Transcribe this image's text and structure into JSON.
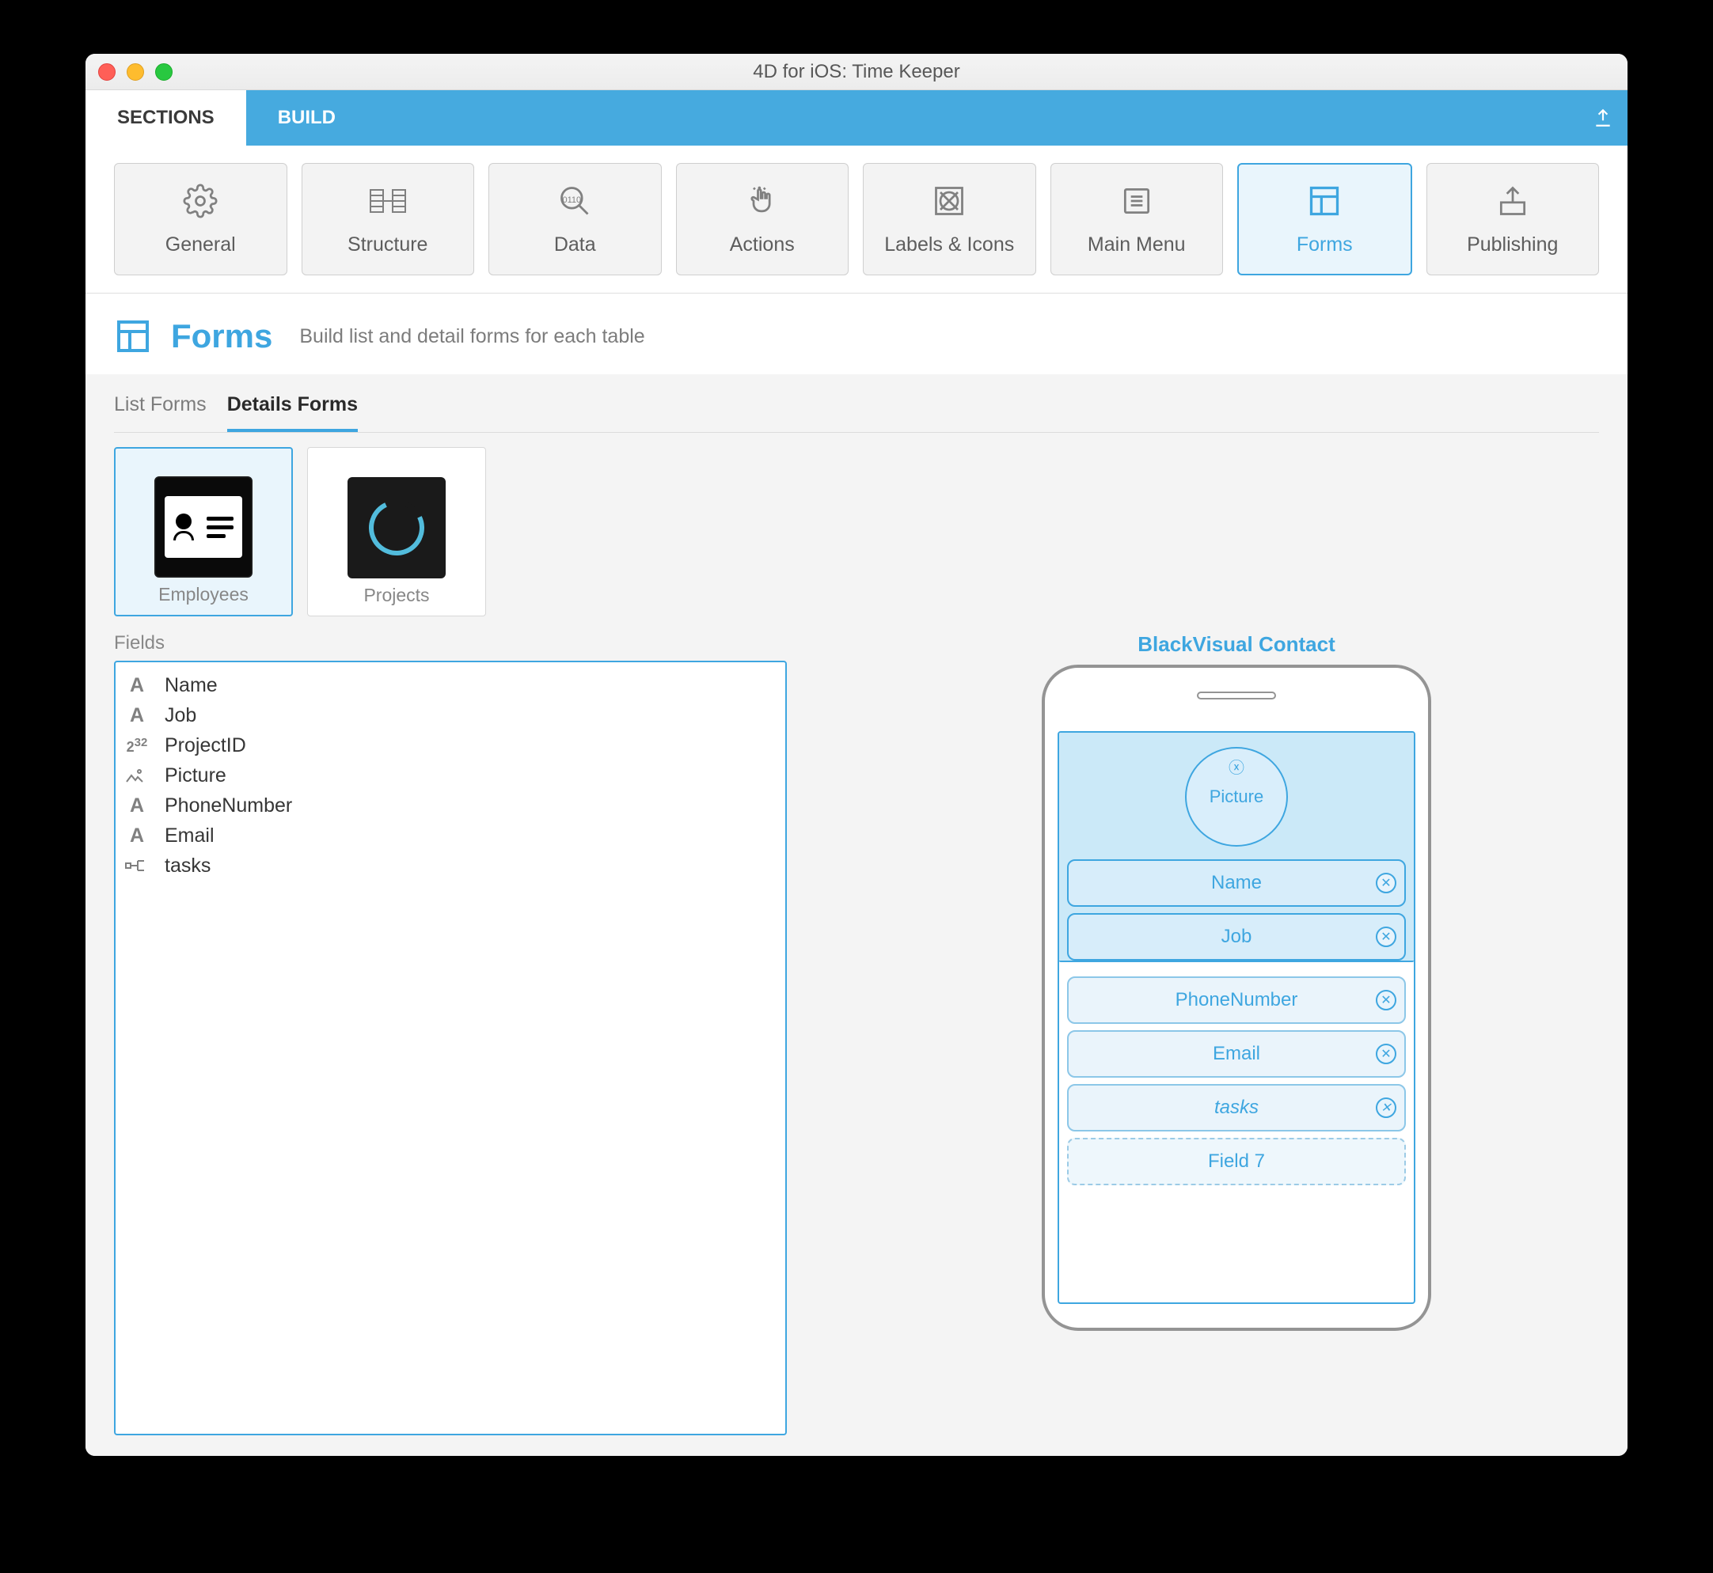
{
  "window": {
    "title": "4D for iOS: Time Keeper"
  },
  "top_tabs": {
    "sections": "SECTIONS",
    "build": "BUILD"
  },
  "nav": {
    "general": "General",
    "structure": "Structure",
    "data": "Data",
    "actions": "Actions",
    "labels": "Labels & Icons",
    "mainmenu": "Main Menu",
    "forms": "Forms",
    "publishing": "Publishing"
  },
  "heading": {
    "title": "Forms",
    "sub": "Build list and detail forms for each table"
  },
  "subtabs": {
    "list": "List Forms",
    "details": "Details Forms"
  },
  "templates": {
    "employees": "Employees",
    "projects": "Projects"
  },
  "fields": {
    "title": "Fields",
    "items": [
      {
        "type": "A",
        "label": "Name"
      },
      {
        "type": "A",
        "label": "Job"
      },
      {
        "type": "int",
        "label": "ProjectID"
      },
      {
        "type": "pic",
        "label": "Picture"
      },
      {
        "type": "A",
        "label": "PhoneNumber"
      },
      {
        "type": "A",
        "label": "Email"
      },
      {
        "type": "rel",
        "label": "tasks"
      }
    ]
  },
  "preview": {
    "title": "BlackVisual Contact",
    "avatar": "Picture",
    "hero_pills": [
      "Name",
      "Job"
    ],
    "body_pills": [
      "PhoneNumber",
      "Email"
    ],
    "italic_pill": "tasks",
    "placeholder": "Field 7"
  }
}
